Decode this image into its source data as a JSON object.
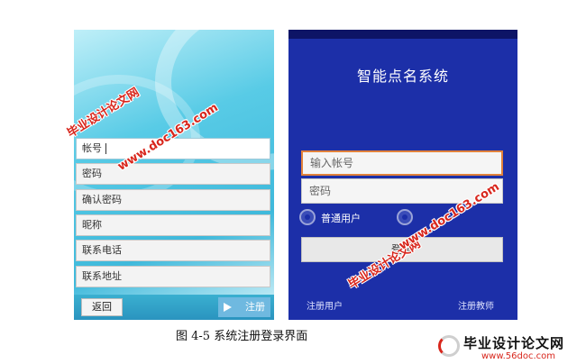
{
  "register_screen": {
    "fields": [
      "帐号",
      "密码",
      "确认密码",
      "昵称",
      "联系电话",
      "联系地址"
    ],
    "back_label": "返回",
    "register_label": "注册"
  },
  "login_screen": {
    "title": "智能点名系统",
    "account_placeholder": "输入帐号",
    "password_placeholder": "密码",
    "radio_normal_label": "普通用户",
    "radio_teacher_label": "",
    "login_label": "登录",
    "register_user_link": "注册用户",
    "register_teacher_link": "注册教师"
  },
  "caption": "图 4-5 系统注册登录界面",
  "watermark": {
    "site_name": "毕业设计论文网",
    "site_url": "www.doc163.com"
  },
  "logo": {
    "brand": "毕业设计论文网",
    "url": "www.56doc.com"
  },
  "colors": {
    "accent_red": "#d8261c",
    "login_bg": "#1c2fa8",
    "focus_orange": "#e2823b"
  }
}
